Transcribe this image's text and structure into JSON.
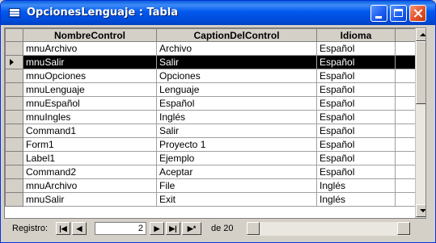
{
  "window": {
    "title": "OpcionesLenguaje : Tabla"
  },
  "table": {
    "columns": [
      "NombreControl",
      "CaptionDelControl",
      "Idioma"
    ],
    "rows": [
      [
        "mnuArchivo",
        "Archivo",
        "Español"
      ],
      [
        "mnuSalir",
        "Salir",
        "Español"
      ],
      [
        "mnuOpciones",
        "Opciones",
        "Español"
      ],
      [
        "mnuLenguaje",
        "Lenguaje",
        "Español"
      ],
      [
        "mnuEspañol",
        "Español",
        "Español"
      ],
      [
        "mnuIngles",
        "Inglés",
        "Español"
      ],
      [
        "Command1",
        "Salir",
        "Español"
      ],
      [
        "Form1",
        "Proyecto 1",
        "Español"
      ],
      [
        "Label1",
        "Ejemplo",
        "Español"
      ],
      [
        "Command2",
        "Aceptar",
        "Español"
      ],
      [
        "mnuArchivo",
        "File",
        "Inglés"
      ],
      [
        "mnuSalir",
        "Exit",
        "Inglés"
      ]
    ],
    "current_row": 1
  },
  "navigator": {
    "label": "Registro:",
    "current_record": "2",
    "of_label": "de 20",
    "first_icon": "first-record-icon",
    "prev_icon": "previous-record-icon",
    "next_icon": "next-record-icon",
    "last_icon": "last-record-icon",
    "new_icon": "new-record-icon"
  },
  "colors": {
    "titlebar": "#0058ee",
    "selected_row": "#000000",
    "window_bg": "#d4d0c8"
  }
}
